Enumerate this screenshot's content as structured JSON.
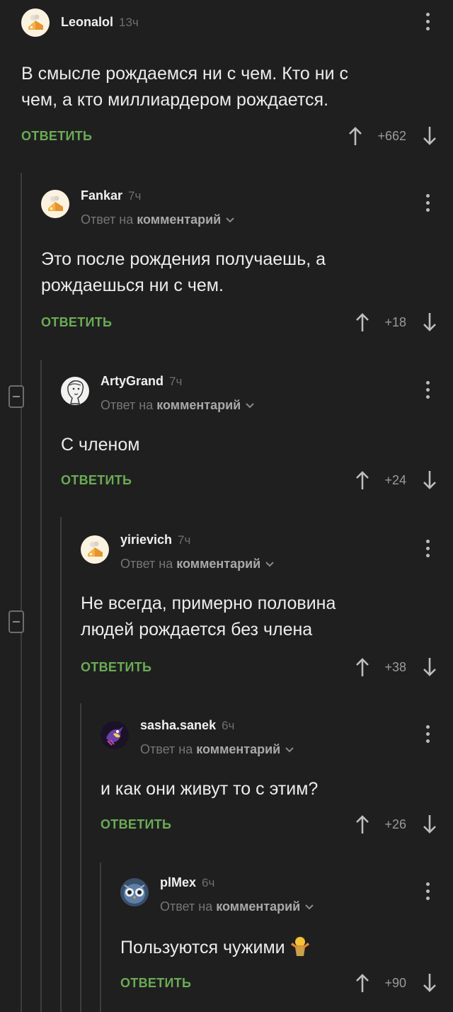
{
  "labels": {
    "reply": "ОТВЕТИТЬ",
    "reply_to_prefix": "Ответ на",
    "reply_to_target": "комментарий"
  },
  "comments": [
    {
      "username": "Leonalol",
      "time": "13ч",
      "text": "В смысле рождаемся ни с чем. Кто ни с\nчем, а кто миллиардером рождается.",
      "score": "+662",
      "is_reply": false,
      "avatar_icon": "cheesecake-avatar-icon"
    },
    {
      "username": "Fankar",
      "time": "7ч",
      "text": "Это после рождения получаешь, а\nрождаешься ни с чем.",
      "score": "+18",
      "is_reply": true,
      "avatar_icon": "cheesecake-avatar-icon"
    },
    {
      "username": "ArtyGrand",
      "time": "7ч",
      "text": "С членом",
      "score": "+24",
      "is_reply": true,
      "avatar_icon": "sketch-portrait-avatar-icon"
    },
    {
      "username": "yirievich",
      "time": "7ч",
      "text": "Не всегда, примерно половина\nлюдей рождается без члена",
      "score": "+38",
      "is_reply": true,
      "avatar_icon": "cheesecake-avatar-icon"
    },
    {
      "username": "sasha.sanek",
      "time": "6ч",
      "text": "и как они живут то с этим?",
      "score": "+26",
      "is_reply": true,
      "avatar_icon": "bird-avatar-icon"
    },
    {
      "username": "plMex",
      "time": "6ч",
      "text": "Пользуются чужими",
      "score": "+90",
      "is_reply": true,
      "avatar_icon": "owl-avatar-icon",
      "text_emoji": "person-shrugging-emoji"
    }
  ],
  "colors": {
    "background": "#1f1f20",
    "accent_green": "#6bab54",
    "muted": "#767677",
    "text": "#ececec"
  }
}
